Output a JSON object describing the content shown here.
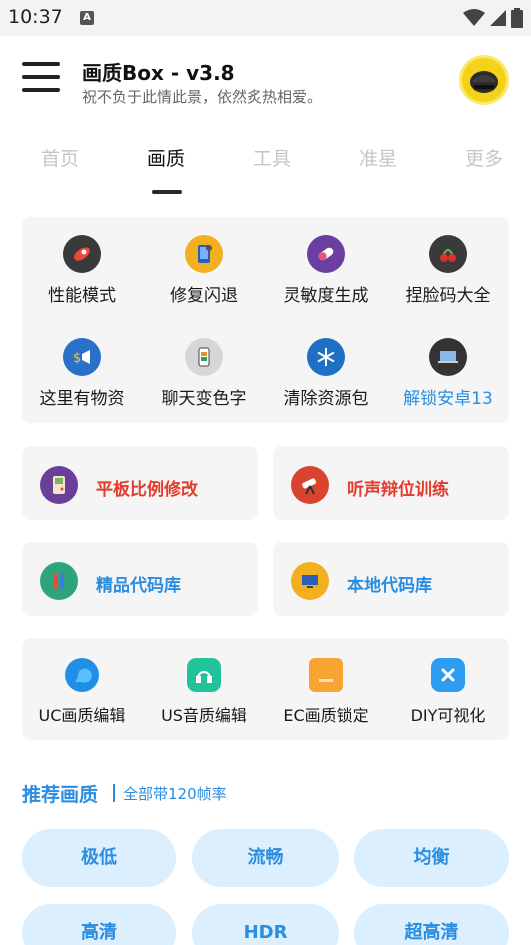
{
  "status_bar": {
    "time": "10:37",
    "notification_glyph": "A"
  },
  "header": {
    "title": "画质Box - v3.8",
    "subtitle": "祝不负于此情此景，依然炙热相爱。",
    "menu_icon": "hamburger-menu-icon",
    "avatar_icon": "helmet-avatar-icon"
  },
  "tabs": [
    {
      "label": "首页",
      "active": false
    },
    {
      "label": "画质",
      "active": true
    },
    {
      "label": "工具",
      "active": false
    },
    {
      "label": "准星",
      "active": false
    },
    {
      "label": "更多",
      "active": false
    }
  ],
  "feature_grid": [
    {
      "label": "性能模式",
      "icon": "rocket-icon"
    },
    {
      "label": "修复闪退",
      "icon": "phone-repair-icon"
    },
    {
      "label": "灵敏度生成",
      "icon": "capsule-icon"
    },
    {
      "label": "捏脸码大全",
      "icon": "cherry-icon"
    },
    {
      "label": "这里有物资",
      "icon": "megaphone-icon"
    },
    {
      "label": "聊天变色字",
      "icon": "color-palette-icon"
    },
    {
      "label": "清除资源包",
      "icon": "snowflake-icon"
    },
    {
      "label": "解锁安卓13",
      "icon": "laptop-icon",
      "highlight": true
    }
  ],
  "wide_cards": [
    {
      "label": "平板比例修改",
      "icon": "gameboy-icon",
      "color": "#e53b2c"
    },
    {
      "label": "听声辩位训练",
      "icon": "telescope-icon",
      "color": "#e53b2c"
    },
    {
      "label": "精品代码库",
      "icon": "test-tube-icon",
      "color": "#2a8de0"
    },
    {
      "label": "本地代码库",
      "icon": "monitor-icon",
      "color": "#2a8de0"
    }
  ],
  "tools": [
    {
      "label": "UC画质编辑",
      "icon": "blue-chat-icon"
    },
    {
      "label": "US音质编辑",
      "icon": "headphone-icon"
    },
    {
      "label": "EC画质锁定",
      "icon": "orange-folder-icon"
    },
    {
      "label": "DIY可视化",
      "icon": "blue-x-icon"
    }
  ],
  "recommended": {
    "title": "推荐画质",
    "subtitle": "全部带120帧率",
    "options": [
      "极低",
      "流畅",
      "均衡",
      "高清",
      "HDR",
      "超高清"
    ]
  },
  "colors": {
    "accent": "#2a8de0",
    "danger": "#e53b2c",
    "pill_bg": "#dcefff",
    "card_bg": "#f5f5f5"
  }
}
